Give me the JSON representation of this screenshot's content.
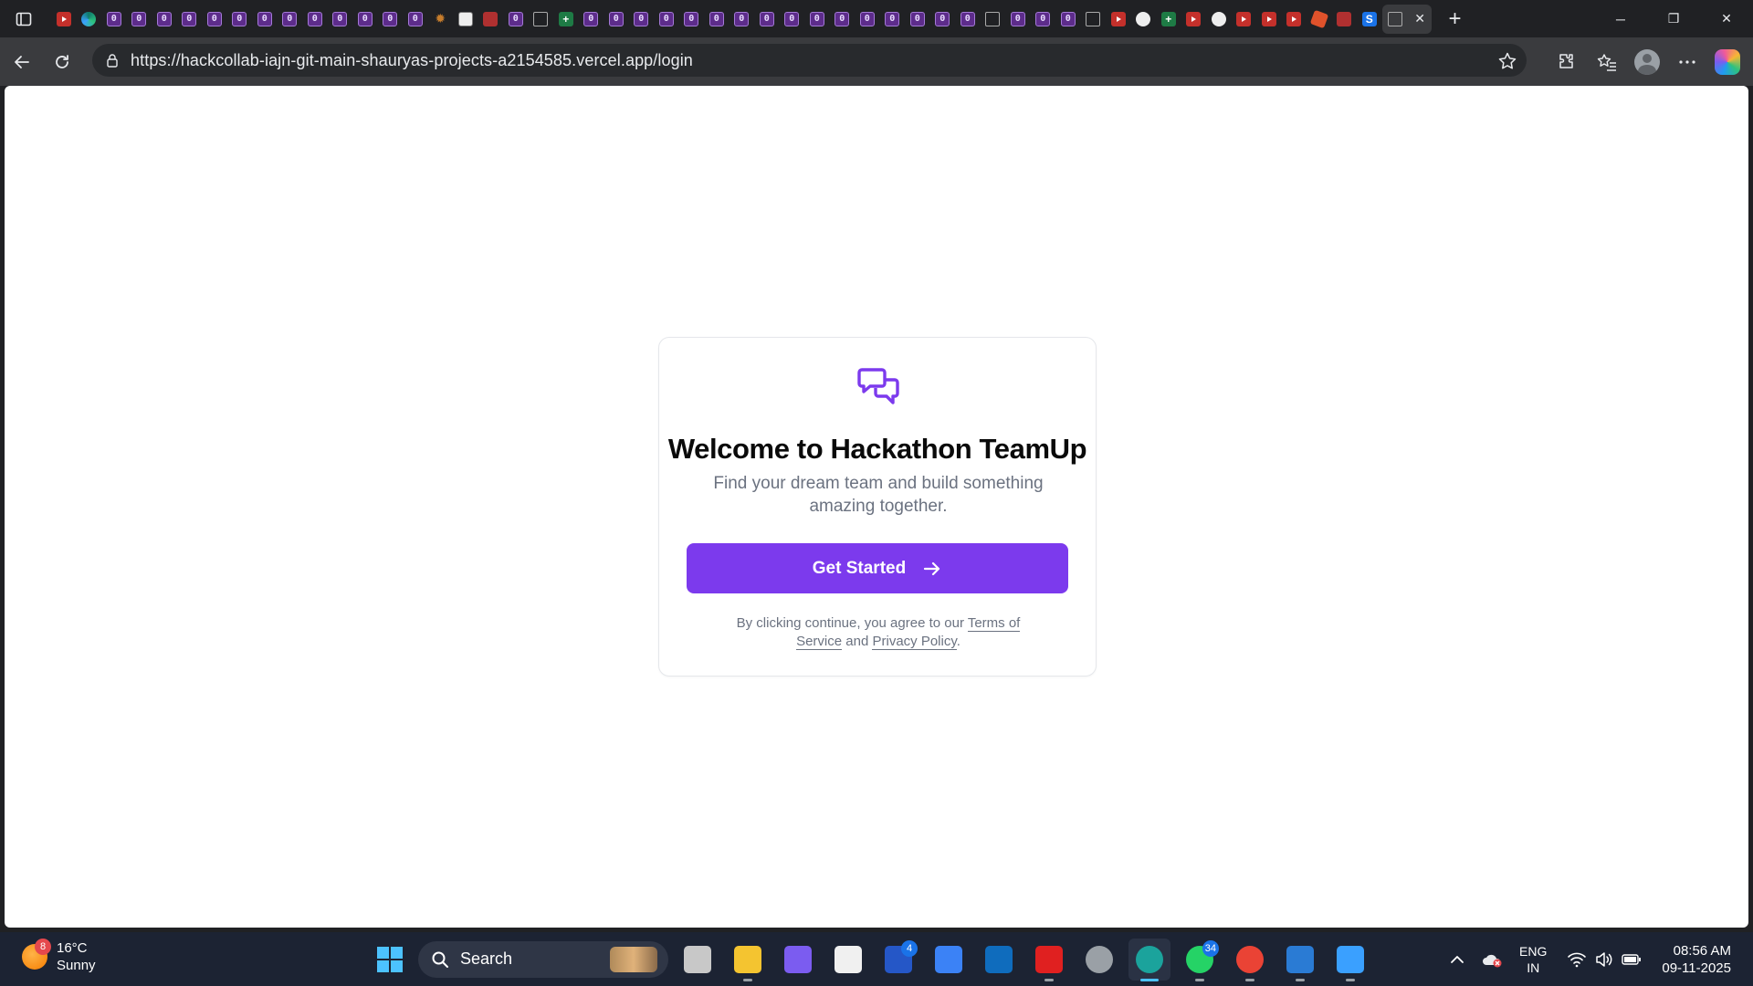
{
  "browser": {
    "url": "https://hackcollab-iajn-git-main-shauryas-projects-a2154585.vercel.app/login",
    "tabs": [
      {
        "icon": "youtube"
      },
      {
        "icon": "edge"
      },
      {
        "icon": "zero"
      },
      {
        "icon": "zero"
      },
      {
        "icon": "zero"
      },
      {
        "icon": "zero"
      },
      {
        "icon": "zero"
      },
      {
        "icon": "zero"
      },
      {
        "icon": "zero"
      },
      {
        "icon": "zero"
      },
      {
        "icon": "zero"
      },
      {
        "icon": "zero"
      },
      {
        "icon": "zero"
      },
      {
        "icon": "zero"
      },
      {
        "icon": "zero"
      },
      {
        "icon": "gear"
      },
      {
        "icon": "doc"
      },
      {
        "icon": "pdf"
      },
      {
        "icon": "zero"
      },
      {
        "icon": "window"
      },
      {
        "icon": "sheet"
      },
      {
        "icon": "zero"
      },
      {
        "icon": "zero"
      },
      {
        "icon": "zero"
      },
      {
        "icon": "zero"
      },
      {
        "icon": "zero"
      },
      {
        "icon": "zero"
      },
      {
        "icon": "zero"
      },
      {
        "icon": "zero"
      },
      {
        "icon": "zero"
      },
      {
        "icon": "zero"
      },
      {
        "icon": "zero"
      },
      {
        "icon": "zero"
      },
      {
        "icon": "zero"
      },
      {
        "icon": "zero"
      },
      {
        "icon": "zero"
      },
      {
        "icon": "zero"
      },
      {
        "icon": "window"
      },
      {
        "icon": "zero"
      },
      {
        "icon": "zero"
      },
      {
        "icon": "zero"
      },
      {
        "icon": "window"
      },
      {
        "icon": "youtube"
      },
      {
        "icon": "github"
      },
      {
        "icon": "sheet"
      },
      {
        "icon": "youtube"
      },
      {
        "icon": "github"
      },
      {
        "icon": "youtube"
      },
      {
        "icon": "youtube"
      },
      {
        "icon": "youtube"
      },
      {
        "icon": "spark"
      },
      {
        "icon": "pdf"
      },
      {
        "icon": "s"
      }
    ],
    "zero_glyph": "0",
    "s_glyph": "S",
    "tab_close": "✕",
    "new_tab": "+",
    "window_controls": {
      "minimize": "─",
      "maximize": "❐",
      "close": "✕"
    }
  },
  "page": {
    "title": "Welcome to Hackathon TeamUp",
    "subtitle": "Find your dream team and build something amazing together.",
    "cta_label": "Get Started",
    "terms_prefix": "By clicking continue, you agree to our ",
    "terms_link": "Terms of Service",
    "terms_middle": " and ",
    "privacy_link": "Privacy Policy",
    "terms_suffix": ".",
    "accent_color": "#7c3aed"
  },
  "taskbar": {
    "weather": {
      "temp": "16°C",
      "condition": "Sunny",
      "badge": "8"
    },
    "search_placeholder": "Search",
    "apps": [
      {
        "name": "task-view",
        "color": "#c8c8c8",
        "badge": ""
      },
      {
        "name": "file-explorer",
        "color": "#f4c430",
        "badge": ""
      },
      {
        "name": "copilot",
        "color": "#7b5cf0",
        "badge": ""
      },
      {
        "name": "microsoft-store",
        "color": "#f0f0f0",
        "badge": ""
      },
      {
        "name": "linkedin",
        "color": "#2557c7",
        "badge": "4"
      },
      {
        "name": "azure",
        "color": "#3b82f6",
        "badge": ""
      },
      {
        "name": "outlook",
        "color": "#0f6cbd",
        "badge": ""
      },
      {
        "name": "youtube",
        "color": "#e02020",
        "badge": ""
      },
      {
        "name": "settings",
        "color": "#9aa0a6",
        "badge": ""
      },
      {
        "name": "edge",
        "color": "#1ba39c",
        "badge": ""
      },
      {
        "name": "whatsapp",
        "color": "#25d366",
        "badge": "34"
      },
      {
        "name": "chrome",
        "color": "#ea4335",
        "badge": ""
      },
      {
        "name": "photos",
        "color": "#2a7bd4",
        "badge": ""
      },
      {
        "name": "paint",
        "color": "#3aa0ff",
        "badge": ""
      }
    ],
    "tray": {
      "chevron": "^",
      "lang_primary": "ENG",
      "lang_secondary": "IN",
      "time": "08:56 AM",
      "date": "09-11-2025"
    }
  }
}
